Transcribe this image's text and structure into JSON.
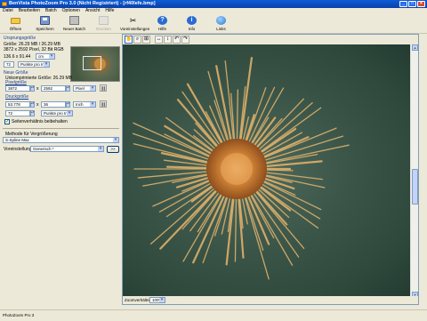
{
  "window": {
    "title": "BenVista PhotoZoom Pro 3.0 (Nicht Registriert) - [rf40lefe.bmp]",
    "buttons": [
      "_",
      "□",
      "×"
    ]
  },
  "menu": [
    "Datei",
    "Bearbeiten",
    "Batch",
    "Optionen",
    "Ansicht",
    "Hilfe"
  ],
  "toolbar": [
    {
      "label": "Öffnen",
      "icon": "folder-open-icon",
      "enabled": true
    },
    {
      "label": "Speichern",
      "icon": "floppy-disk-icon",
      "enabled": true
    },
    {
      "label": "Neuer Batch",
      "icon": "batch-icon",
      "enabled": true
    },
    {
      "label": "Drucken",
      "icon": "printer-icon",
      "enabled": false
    },
    {
      "label": "Voreinstellungen",
      "icon": "tools-icon",
      "enabled": true
    },
    {
      "label": "Hilfe",
      "icon": "help-icon",
      "glyph": "?",
      "color": "#2a6bd6",
      "enabled": true
    },
    {
      "label": "Info",
      "icon": "info-icon",
      "glyph": "i",
      "color": "#2a6bd6",
      "enabled": true
    },
    {
      "label": "Links",
      "icon": "globe-icon",
      "glyph": "",
      "color": "#3a8fe0",
      "enabled": true
    }
  ],
  "original": {
    "heading": "Ursprungsgröße",
    "size": "Größe: 26.29 MB / 26.29 MB",
    "dims": "3872 x 2592 Pixel, 32 Bit RGB",
    "print_size": "136.6 x 91.44",
    "print_unit": "cm",
    "res_value": "72",
    "res_unit": "Punkte pro Inch"
  },
  "new_size": {
    "heading": "Neue Größe",
    "uncompressed": "Unkomprimierte Größe: 26.29 MB",
    "pixel_heading": "Pixelgröße",
    "width": "3872",
    "height": "2592",
    "pixel_unit": "Pixel",
    "print_heading": "Druckgröße",
    "print_width": "53.778",
    "print_height": "36",
    "print_unit": "Inch",
    "resolution": "72",
    "res_unit": "Punkte pro Inch",
    "times": "x",
    "keep_ratio_label": "Seitenverhältnis beibehalten",
    "keep_ratio_checked": "✓"
  },
  "method": {
    "heading": "Methode für Vergrößerung",
    "value": "S-Spline Max",
    "presets_label": "Voreinstellungen:",
    "presets_value": "Generisch *",
    "more_button": ">>"
  },
  "viewer": {
    "zoom_label": "Zoomverhältnis:",
    "zoom_value": "100%"
  },
  "status": {
    "text": "PhotoZoom Pro 3"
  }
}
